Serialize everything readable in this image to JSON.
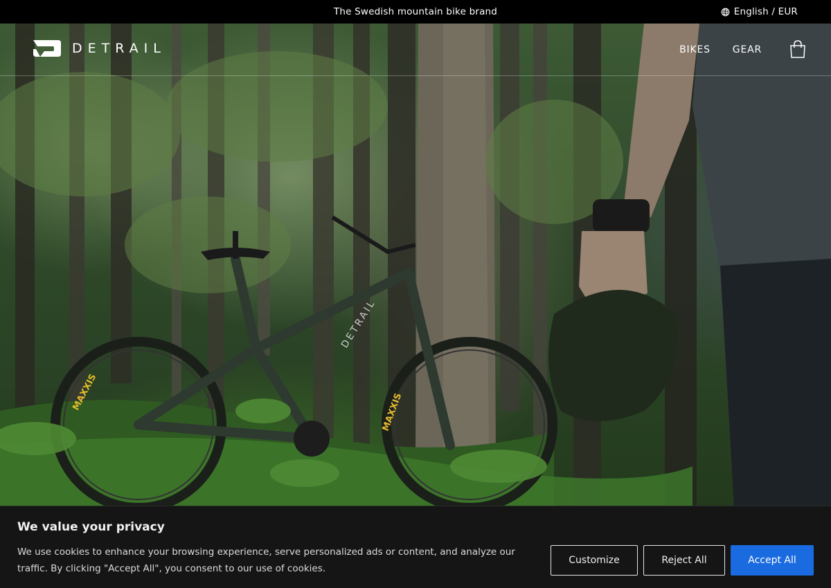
{
  "topbar": {
    "announcement": "The Swedish mountain bike brand",
    "language_label": "English / EUR",
    "globe_icon": "globe-icon"
  },
  "brand": {
    "logo_text": "DETRAIL",
    "logo_icon": "detrail-logo-mark"
  },
  "nav": {
    "items": [
      {
        "label": "BIKES"
      },
      {
        "label": "GEAR"
      }
    ],
    "cart_icon": "shopping-bag-icon"
  },
  "hero": {
    "frame_text": "DETRAIL",
    "tire_text": "MAXXIS"
  },
  "cookie_banner": {
    "title": "We value your privacy",
    "text": "We use cookies to enhance your browsing experience, serve personalized ads or content, and analyze our traffic. By clicking \"Accept All\", you consent to our use of cookies.",
    "customize_label": "Customize",
    "reject_label": "Reject All",
    "accept_label": "Accept All",
    "accent_color": "#1a6ae0"
  }
}
